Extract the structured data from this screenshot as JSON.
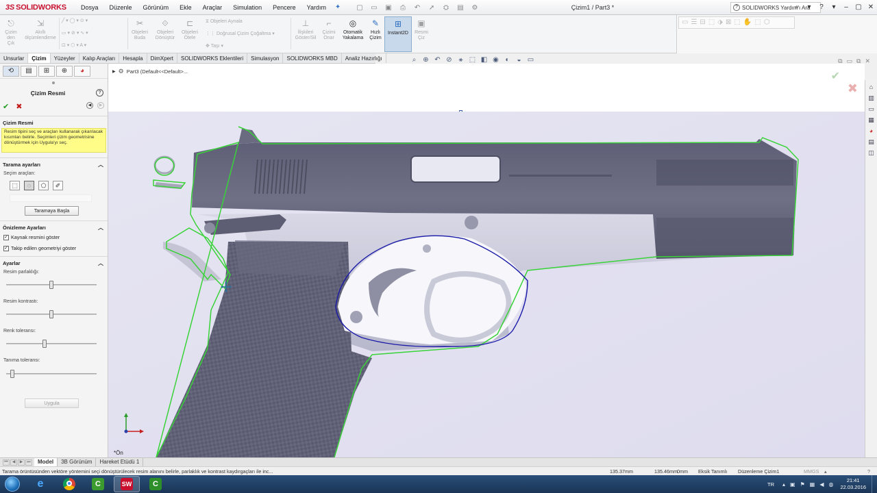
{
  "app": {
    "logo_text": "SOLIDWORKS",
    "doc_title": "Çizim1 / Part3 *",
    "help_search_placeholder": "SOLIDWORKS Yardım'ı Ara",
    "brand_color": "#c8102e"
  },
  "menu": [
    "Dosya",
    "Düzenle",
    "Görünüm",
    "Ekle",
    "Araçlar",
    "Simulation",
    "Pencere",
    "Yardım"
  ],
  "ribbon": {
    "cizimden_cik": "Çizim\nden\nÇık",
    "akilli_olcum": "Akıllı\nölçümlendirme",
    "objeleri_buda": "Objeleri\nBuda",
    "objeleri_donustur": "Objeleri\nDönüştür",
    "objeleri_otele": "Objeleri\nÖtele",
    "objeleri_aynala": "Objeleri Aynala",
    "dogrusal_cizim": "Doğrusal Çizim Çoğaltma",
    "tasi": "Taşı",
    "iliskileri_goster": "İlişkileri\nGöster/Sil",
    "cizimi_onar": "Çizimi\nOnar",
    "otomatik_yakalama": "Otomatik\nYakalama",
    "hizli_cizim": "Hızlı\nÇizim",
    "instant2d": "Instant2D",
    "resmi_ciz": "Resmi\nÇiz"
  },
  "tabs": [
    "Unsurlar",
    "Çizim",
    "Yüzeyler",
    "Kalıp Araçları",
    "Hesapla",
    "DimXpert",
    "SOLIDWORKS Eklentileri",
    "Simulasyon",
    "SOLIDWORKS MBD",
    "Analiz Hazırlığı"
  ],
  "active_tab": "Çizim",
  "panel": {
    "title": "Çizim Resmi",
    "section_cizim_resmi": "Çizim Resmi",
    "message": "Resim tipini seç ve araçları kullanarak çıkarılacak kısımları belirle. Seçimleri çizim geometrisine dönüştürmek için Uygula'yı seç.",
    "section_tarama": "Tarama ayarları",
    "secim_araclari": "Seçim araçları:",
    "taramaya_basla": "Taramaya Başla",
    "section_onizleme": "Önizleme Ayarları",
    "chk_kaynak": "Kaynak resmini göster",
    "chk_takip": "Takip edilen geometriyi göster",
    "section_ayarlar": "Ayarlar",
    "resim_parlakligi": "Resim parlaklığı:",
    "resim_kontrasti": "Resim kontrastı:",
    "renk_toleransi": "Renk toleransı:",
    "tanima_toleransi": "Tanıma toleransı:",
    "uygula": "Uygula",
    "slider_parlaklik": 0.5,
    "slider_kontrast": 0.5,
    "slider_renk": 0.42,
    "slider_tanima": 0.05
  },
  "graphics": {
    "tree_label": "Part3  (Default<<Default>...",
    "view_label": "*Ön",
    "trace_green": "#39d339",
    "trace_blue": "#1a1aa8"
  },
  "bottom_tabs": [
    "Model",
    "3B Görünüm",
    "Hareket Etüdü 1"
  ],
  "active_bottom_tab": "Model",
  "status": {
    "message": "Tarama örüntüsünden vektöre yöntemini seçi dönüştürülecek resim alanını belirle, parlaklık ve kontrast kaydırgaçları ile inc...",
    "x": "135.37mm",
    "y": "135.46mm",
    "z": "0mm",
    "state": "Eksik Tanımlı",
    "editing": "Düzenleme Çizim1",
    "units": "MMGS"
  },
  "taskbar": {
    "lang": "TR",
    "time": "21:41",
    "date": "22.03.2016"
  }
}
